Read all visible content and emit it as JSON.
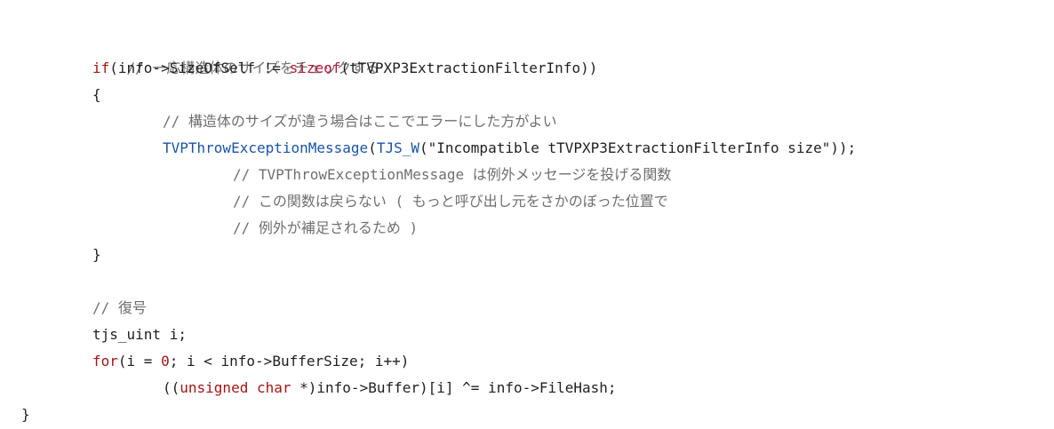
{
  "code": {
    "lines": [
      {
        "cm": "// 一応構造体のサイズをチェックする"
      },
      {
        "kw": "if",
        "rest": "(info->SizeOfSelf != ",
        "kw2": "sizeof",
        "rest2": "(tTVPXP3ExtractionFilterInfo))"
      },
      {
        "text": "{"
      },
      {
        "cm": "// 構造体のサイズが違う場合はここでエラーにした方がよい"
      },
      {
        "fn": "TVPThrowExceptionMessage",
        "p1": "(",
        "fn2": "TJS_W",
        "rest": "(\"Incompatible tTVPXP3ExtractionFilterInfo size\"));"
      },
      {
        "cm": "// TVPThrowExceptionMessage は例外メッセージを投げる関数"
      },
      {
        "cm": "// この関数は戻らない ( もっと呼び出し元をさかのぼった位置で"
      },
      {
        "cm": "// 例外が補足されるため )"
      },
      {
        "text": "}"
      },
      {
        "cm": "// 復号"
      },
      {
        "text": "tjs_uint i;"
      },
      {
        "kw": "for",
        "p1": "(i = ",
        "num": "0",
        "rest": "; i < info->BufferSize; i++)"
      },
      {
        "p1": "((",
        "kw": "unsigned",
        "sp": " ",
        "kw2": "char",
        "rest": " *)info->Buffer)[i] ^= info->FileHash;"
      },
      {
        "text": "}"
      }
    ]
  }
}
